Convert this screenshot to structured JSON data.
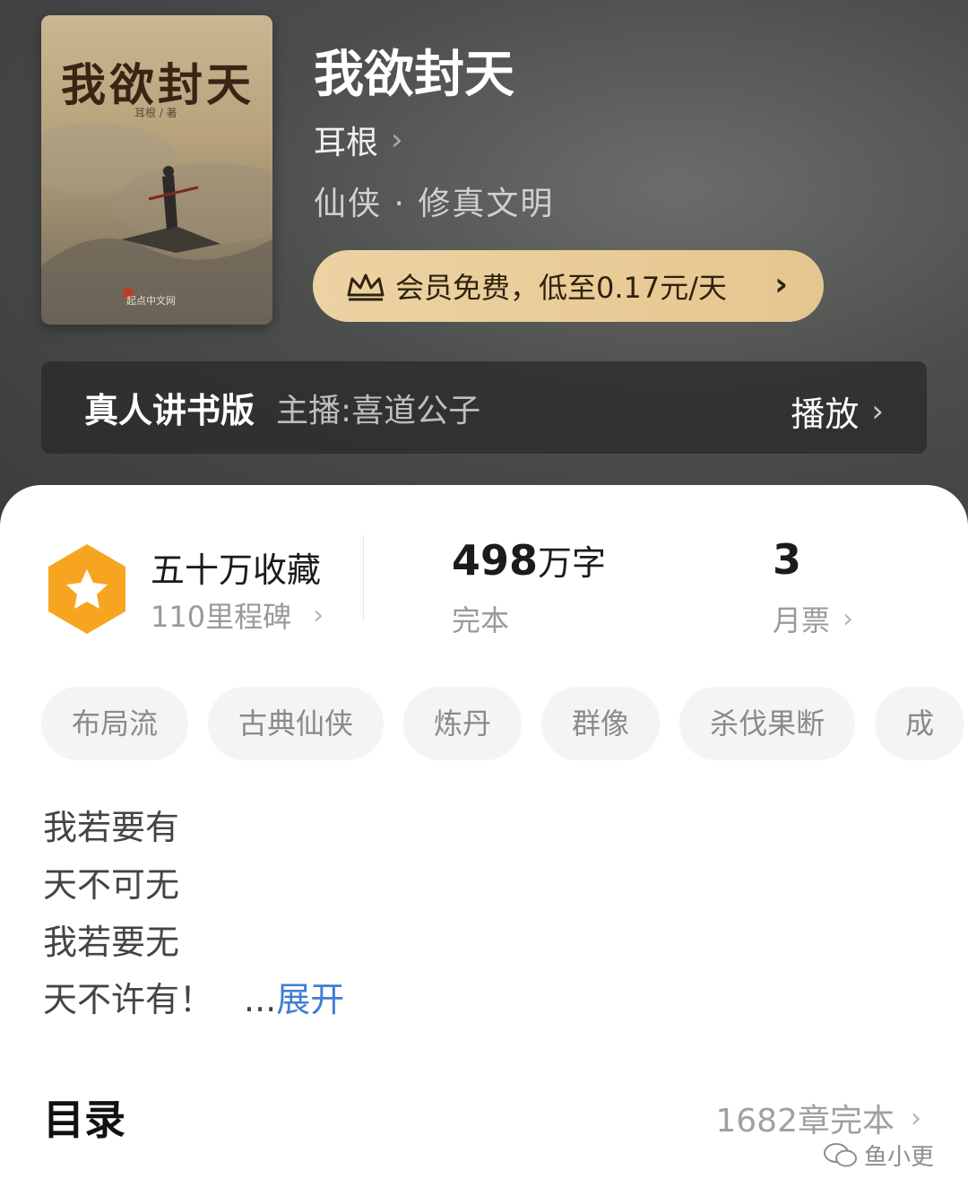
{
  "book": {
    "title": "我欲封天",
    "author": "耳根",
    "genre": "仙侠 · 修真文明",
    "cover": {
      "title": "我欲封天",
      "subtitle": "耳根 / 著",
      "publisher": "起点中文网"
    }
  },
  "vip": {
    "label": "会员免费，低至0.17元/天"
  },
  "audio": {
    "label": "真人讲书版",
    "host": "主播:喜道公子",
    "play_label": "播放"
  },
  "stats": {
    "favorites": {
      "title": "五十万收藏",
      "sub": "110里程碑"
    },
    "words": {
      "number": "498",
      "unit": "万字",
      "status": "完本"
    },
    "monthly_votes": {
      "number": "3",
      "label": "月票"
    }
  },
  "tags": [
    "布局流",
    "古典仙侠",
    "炼丹",
    "群像",
    "杀伐果断",
    "成"
  ],
  "intro": {
    "lines": [
      "我若要有",
      "天不可无",
      "我若要无",
      "天不许有！"
    ],
    "ellipsis": "...",
    "expand_label": "展开"
  },
  "toc": {
    "title": "目录",
    "info": "1682章完本"
  },
  "watermark": "鱼小更",
  "colors": {
    "vip_gold": "#e6c68f",
    "badge_orange": "#f7a520",
    "link_blue": "#3f7ed3"
  }
}
